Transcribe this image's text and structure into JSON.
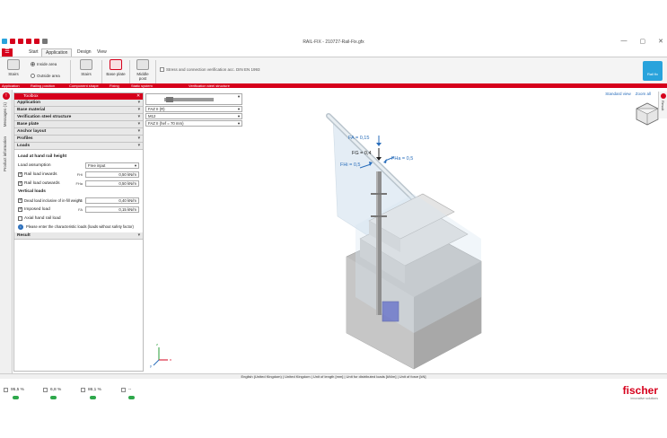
{
  "window": {
    "title": "RAIL-FIX - 210727-Rail-Fix.gfx",
    "controls": [
      "—",
      "▢",
      "✕"
    ]
  },
  "tabs": [
    "Start",
    "Application",
    "Design",
    "View"
  ],
  "ribbon": {
    "stairs": "Stairs",
    "inside_area": "Inside area",
    "outside_area": "Outside area",
    "stairs2": "Stairs",
    "base_plate": "Base plate",
    "middle_post": "Middle post",
    "stress_check": "Stress and connection verification acc. DIN EN 1993",
    "big_button": "Rail fix",
    "groups": [
      "Application",
      "Railing position",
      "Component shape",
      "Fixing",
      "Static system",
      "Verification steel structure"
    ]
  },
  "left_tabs": [
    "Messages (1)",
    "Product information"
  ],
  "toolbox": {
    "title": "Toolbox",
    "sections_top": [
      "Application",
      "Base material",
      "Verification steel structure",
      "Base plate",
      "Anchor layout",
      "Profiles",
      "Loads"
    ],
    "load_title": "Load at hand rail height",
    "load_assumption_label": "Load assumption",
    "load_assumption_value": "Free input",
    "rail_inwards": {
      "label": "Rail load inwards",
      "sym": "FHi",
      "value": "0,50 kN/m"
    },
    "rail_outwards": {
      "label": "Rail load outwards",
      "sym": "FHa",
      "value": "0,50 kN/m"
    },
    "vertical_title": "Vertical loads",
    "dead_load": {
      "label": "Dead load inclusive of in-fill weight",
      "sym": "FG",
      "value": "0,40 kN/m"
    },
    "imposed_load": {
      "label": "Imposed load",
      "sym": "FA",
      "value": "0,15 kN/m"
    },
    "axial_load": "Axial hand rail load",
    "info_text": "Please enter the characteristic loads (loads without safety factor)",
    "result": "Result"
  },
  "viewport": {
    "combos": [
      "FAZ II (R)",
      "M12",
      "FAZ II (hef = 70 mm)"
    ],
    "view_links": [
      "Standard view",
      "Zoom all"
    ],
    "forces": {
      "FA": "FA = 0,15",
      "FG": "FG = 0,4",
      "FHa": "FHa = 0,5",
      "FHi": "FHi = 0,5"
    },
    "axes": {
      "x": "x",
      "y": "y",
      "z": "z"
    },
    "right_tab": "Result"
  },
  "statusbar": "English (United Kingdom) | United Kingdom | Unit of length [mm] | Unit for distributed loads [kN/m] | Unit of force [kN]",
  "bottom": {
    "metrics": [
      "95,5 %",
      "6,8 %",
      "86,1 %",
      "--"
    ],
    "brand": "fischer",
    "slogan": "innovative solutions"
  },
  "colors": {
    "accent": "#d6001c",
    "link": "#2a6ebb",
    "ok": "#2ea84b"
  }
}
